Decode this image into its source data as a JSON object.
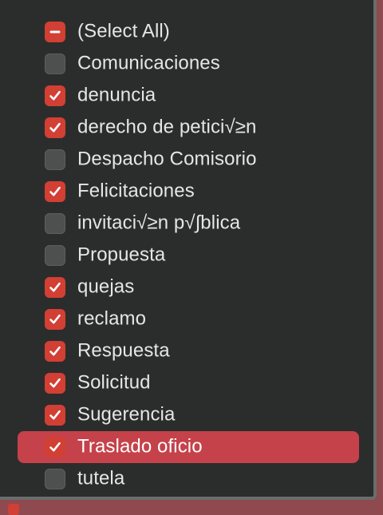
{
  "filter_list": {
    "items": [
      {
        "label": "(Select All)",
        "state": "mixed",
        "highlighted": false
      },
      {
        "label": "Comunicaciones",
        "state": "unchecked",
        "highlighted": false
      },
      {
        "label": "denuncia",
        "state": "checked",
        "highlighted": false
      },
      {
        "label": "derecho de petici√≥n",
        "state": "checked",
        "highlighted": false
      },
      {
        "label": "Despacho Comisorio",
        "state": "unchecked",
        "highlighted": false
      },
      {
        "label": "Felicitaciones",
        "state": "checked",
        "highlighted": false
      },
      {
        "label": "invitaci√≥n p√∫blica",
        "state": "unchecked",
        "highlighted": false
      },
      {
        "label": "Propuesta",
        "state": "unchecked",
        "highlighted": false
      },
      {
        "label": "quejas",
        "state": "checked",
        "highlighted": false
      },
      {
        "label": "reclamo",
        "state": "checked",
        "highlighted": false
      },
      {
        "label": "Respuesta",
        "state": "checked",
        "highlighted": false
      },
      {
        "label": "Solicitud",
        "state": "checked",
        "highlighted": false
      },
      {
        "label": "Sugerencia",
        "state": "checked",
        "highlighted": false
      },
      {
        "label": "Traslado oficio",
        "state": "checked",
        "highlighted": true
      },
      {
        "label": "tutela",
        "state": "unchecked",
        "highlighted": false
      }
    ]
  },
  "colors": {
    "panel_background": "#2b2d2c",
    "checkbox_accent": "#d23f34",
    "highlight": "#c5424a",
    "text": "#e6e6e6"
  }
}
